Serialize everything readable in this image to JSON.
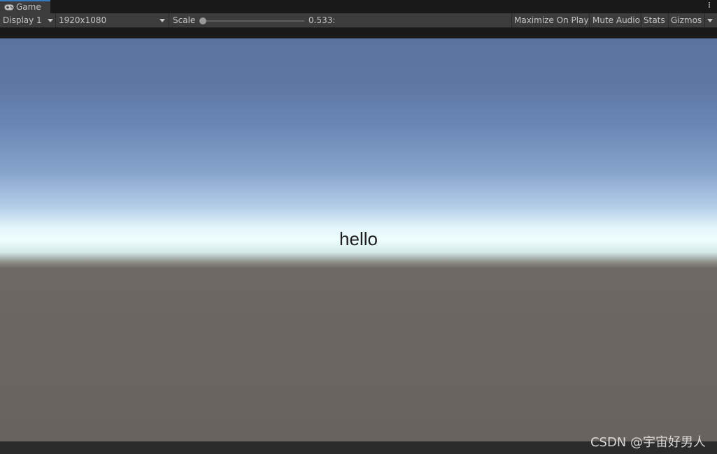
{
  "window": {
    "tab_label": "Game",
    "tab_icon": "gamepad-icon",
    "menu_icon": "kebab-menu-icon"
  },
  "toolbar": {
    "display_select": "Display 1",
    "resolution_select": "1920x1080",
    "scale_label": "Scale",
    "scale_value": "0.533:",
    "scale_fraction": 0.0,
    "maximize_label": "Maximize On Play",
    "mute_label": "Mute Audio",
    "stats_label": "Stats",
    "gizmos_label": "Gizmos"
  },
  "viewport": {
    "text": "hello",
    "sky_color_top": "#5b739f",
    "horizon_color": "#eefefd",
    "ground_color": "#6a625d"
  },
  "watermark": {
    "text": "CSDN @宇宙好男人"
  }
}
